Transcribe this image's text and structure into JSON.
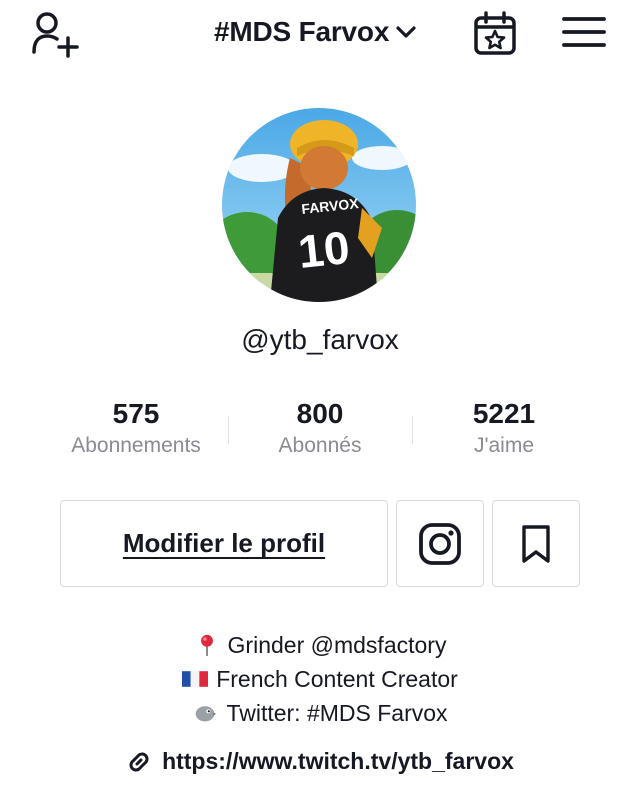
{
  "header": {
    "title": "#MDS Farvox",
    "icons": {
      "add_user": "add-user-icon",
      "dropdown": "chevron-down-icon",
      "calendar": "calendar-star-icon",
      "menu": "hamburger-menu-icon"
    }
  },
  "profile": {
    "avatar": "avatar",
    "avatar_text": {
      "name": "FARVOX",
      "number": "10"
    },
    "handle": "@ytb_farvox"
  },
  "stats": [
    {
      "value": "575",
      "label": "Abonnements"
    },
    {
      "value": "800",
      "label": "Abonnés"
    },
    {
      "value": "5221",
      "label": "J'aime"
    }
  ],
  "actions": {
    "edit_profile_label": "Modifier le profil",
    "instagram_icon": "instagram-icon",
    "bookmark_icon": "bookmark-icon"
  },
  "bio": {
    "lines": [
      {
        "emoji": "pin-emoji",
        "text": "Grinder @mdsfactory"
      },
      {
        "emoji": "france-flag-emoji",
        "text": "French Content Creator"
      },
      {
        "emoji": "bird-emoji",
        "text": "Twitter: #MDS Farvox"
      }
    ]
  },
  "link": {
    "icon": "link-icon",
    "url": "https://www.twitch.tv/ytb_farvox"
  },
  "colors": {
    "text": "#161823",
    "muted": "#8a8b91",
    "border": "#d9d9db",
    "background": "#ffffff"
  }
}
